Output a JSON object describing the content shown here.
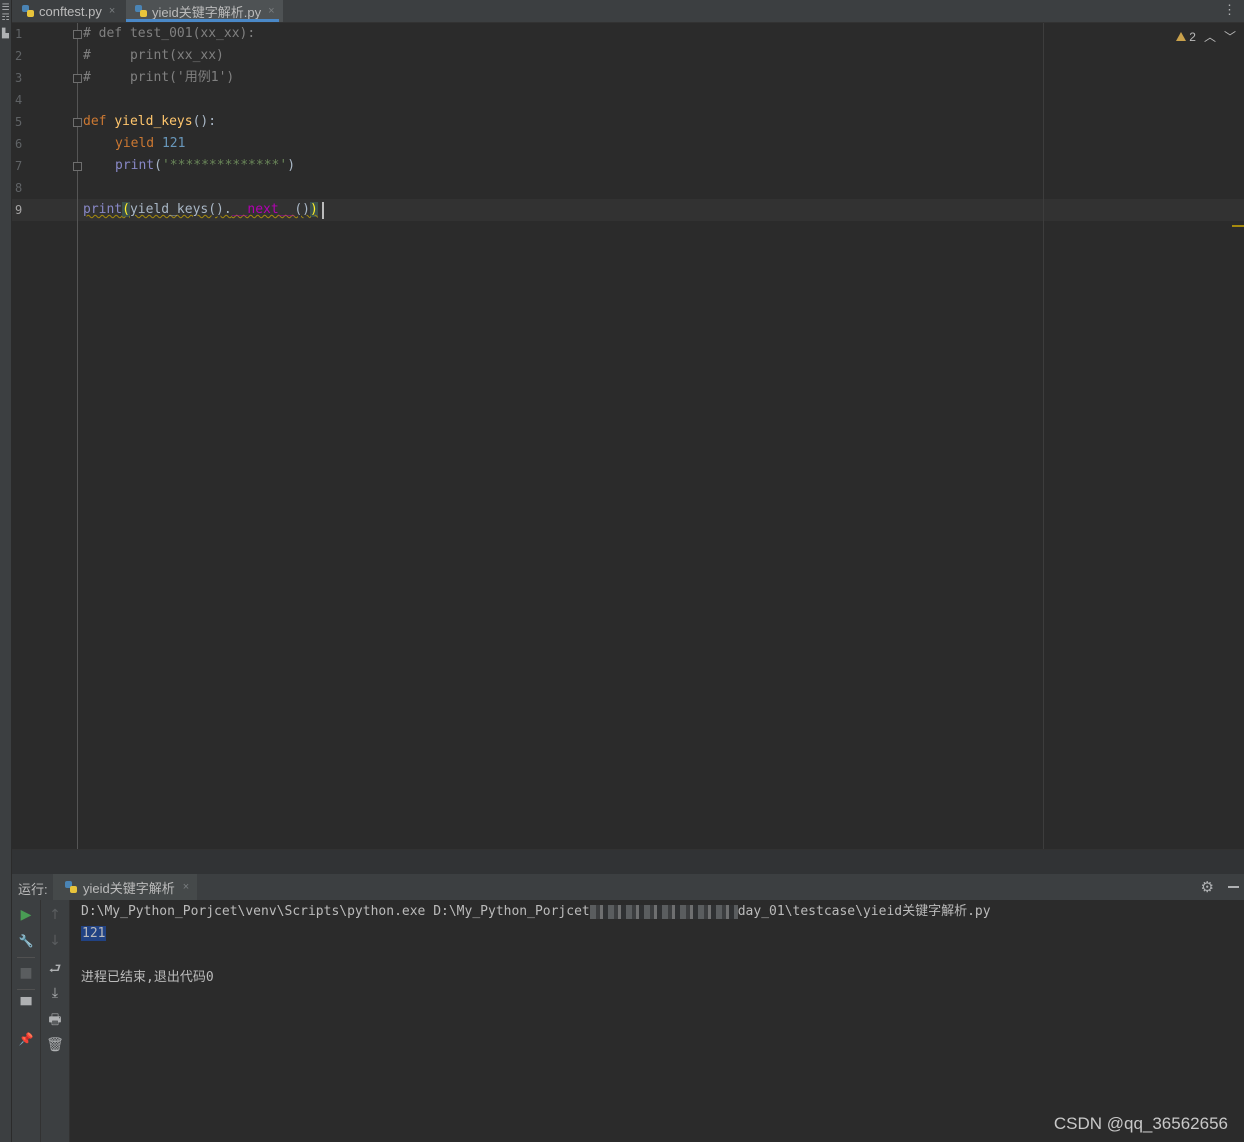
{
  "left_strip": {
    "glyphs": [
      "☰",
      "☶",
      "▙"
    ]
  },
  "tabs": [
    {
      "label": "conftest.py",
      "close": "×"
    },
    {
      "label": "yieid关键字解析.py",
      "close": "×"
    }
  ],
  "tabbar_menu": "⋮",
  "inspection": {
    "warnings": "2",
    "up": "︿",
    "down": "﹀"
  },
  "editor": {
    "line_numbers": [
      "1",
      "2",
      "3",
      "4",
      "5",
      "6",
      "7",
      "8",
      "9"
    ],
    "lines": {
      "l1": "# def test_001(xx_xx):",
      "l2": "#     print(xx_xx)",
      "l3": "#     print('用例1')",
      "l5_kw": "def ",
      "l5_fn": "yield_keys",
      "l5_rest": "():",
      "l6_kw": "yield ",
      "l6_num": "121",
      "l7_builtin": "print",
      "l7_open": "(",
      "l7_str": "'**************'",
      "l7_close": ")",
      "l9_builtin": "print",
      "l9_open": "(",
      "l9_mid": "yield_keys().",
      "l9_magic": "__next__",
      "l9_call": "()",
      "l9_close": ")"
    }
  },
  "run_panel": {
    "label": "运行:",
    "tab_label": "yieid关键字解析",
    "tab_close": "×",
    "gear": "⚙",
    "console": {
      "cmd_prefix": "D:\\My_Python_Porjcet\\venv\\Scripts\\python.exe D:\\My_Python_Porjcet",
      "cmd_suffix": "day_01\\testcase\\yieid关键字解析.py",
      "output": "121",
      "exit_message": "进程已结束,退出代码0"
    }
  },
  "toolbar_icons": {
    "run": "▶",
    "wrench": "🔧",
    "stop": "■",
    "layout": "▀",
    "pin": "📌",
    "up": "↑",
    "down": "↓",
    "wrap": "⮐",
    "scroll_end": "⤓",
    "print": "🖶",
    "trash": "🗑"
  },
  "colors": {
    "editor_bg": "#2b2b2b",
    "panel_bg": "#3c3f41",
    "keyword": "#cc7832",
    "function": "#ffc66d",
    "number": "#6897bb",
    "string": "#6a8759",
    "comment": "#808080",
    "builtin": "#8888c6",
    "magic": "#b200b2",
    "run_green": "#499c54",
    "selection": "#214283",
    "tab_underline": "#4a88c7"
  },
  "watermark": "CSDN @qq_36562656"
}
